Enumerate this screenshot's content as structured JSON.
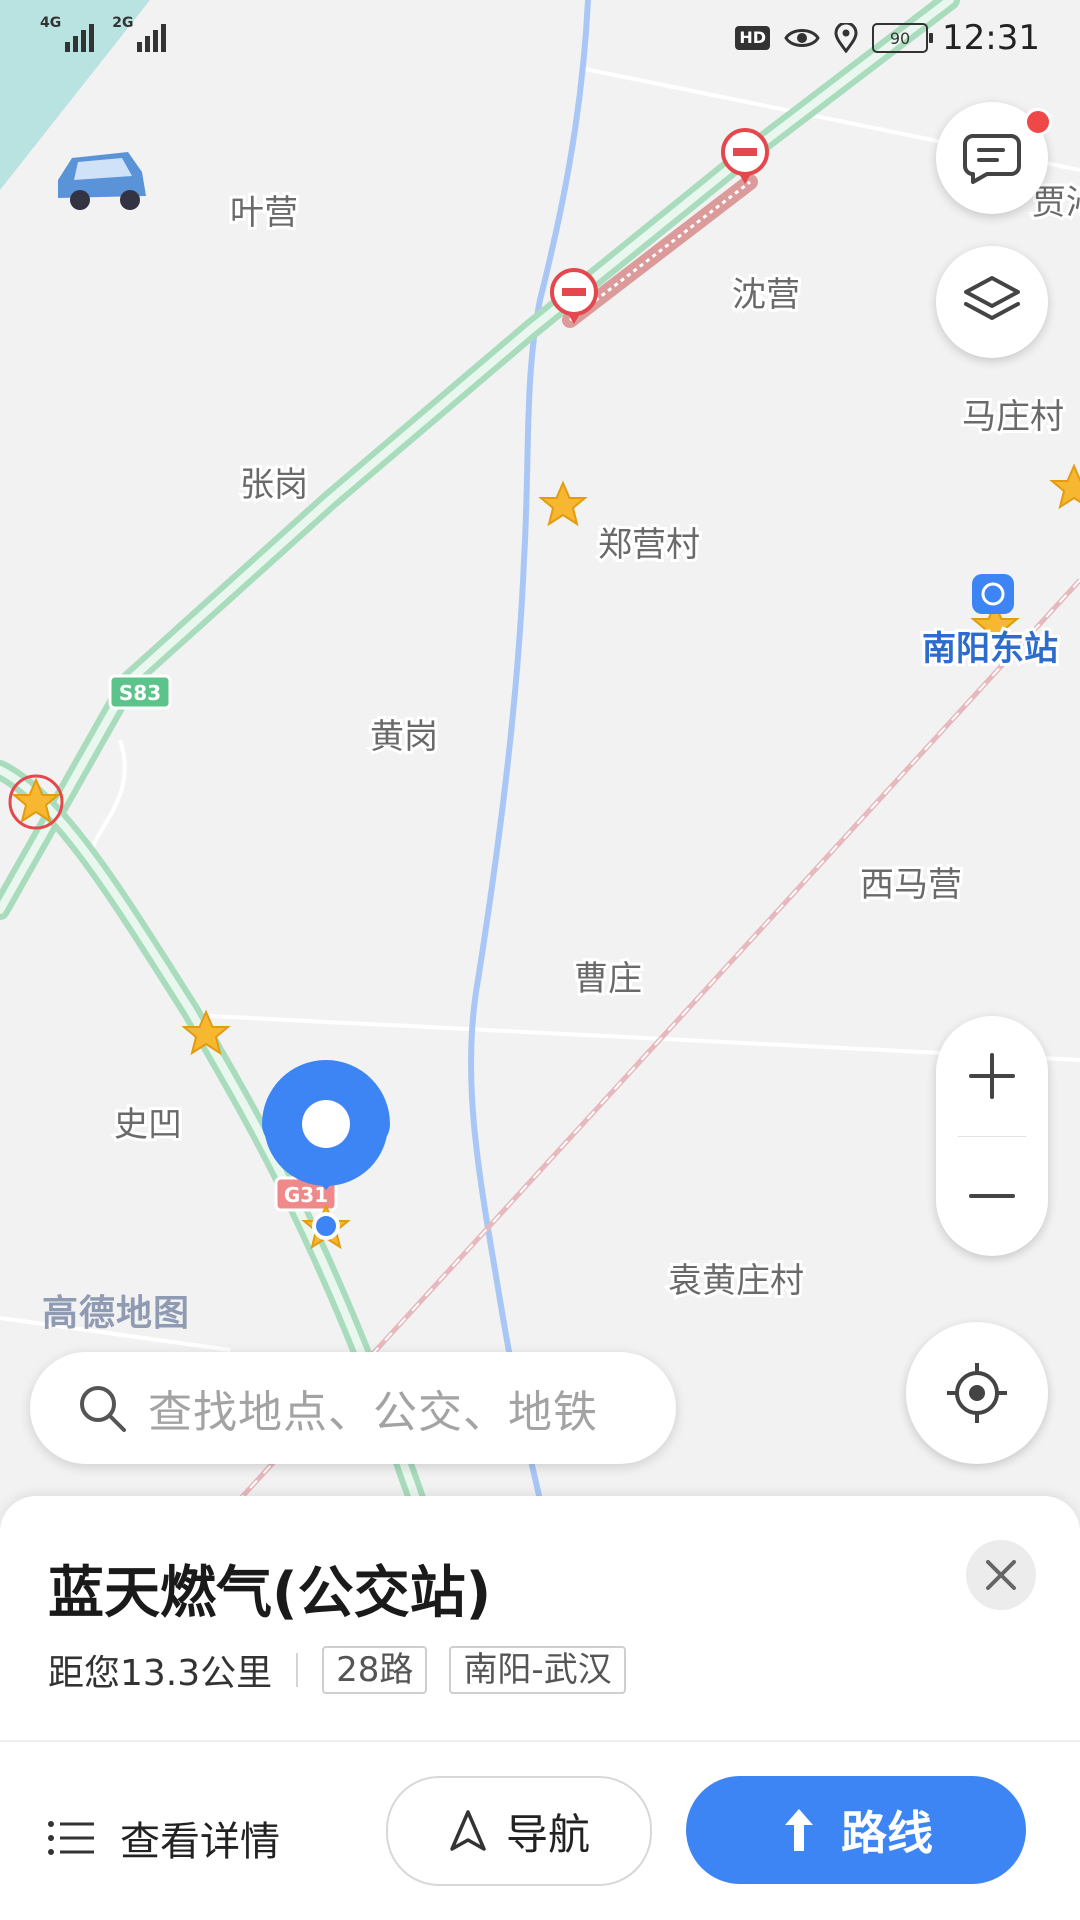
{
  "status_bar": {
    "net1": "4G",
    "net2": "2G",
    "hd": "HD",
    "battery": "90",
    "time": "12:31"
  },
  "map": {
    "places": [
      {
        "id": "yeying",
        "name": "叶营"
      },
      {
        "id": "shenying",
        "name": "沈营"
      },
      {
        "id": "jia",
        "name": "贾沁"
      },
      {
        "id": "mazhuangcun",
        "name": "马庄村"
      },
      {
        "id": "zhanggang",
        "name": "张岗"
      },
      {
        "id": "zhengyingcun",
        "name": "郑营村"
      },
      {
        "id": "huanggang",
        "name": "黄岗"
      },
      {
        "id": "ximaying",
        "name": "西马营"
      },
      {
        "id": "caozhuang",
        "name": "曹庄"
      },
      {
        "id": "shiao",
        "name": "史凹"
      },
      {
        "id": "yuanhuangzhuangcun",
        "name": "袁黄庄村"
      }
    ],
    "station_label": "南阳东站",
    "road_shield_s83": "S83",
    "road_shield_g31": "G31",
    "watermark": "高德地图"
  },
  "search": {
    "placeholder": "查找地点、公交、地铁"
  },
  "poi_panel": {
    "title": "蓝天燃气(公交站)",
    "distance": "距您13.3公里",
    "tags": [
      "28路",
      "南阳-武汉"
    ],
    "actions": {
      "details": "查看详情",
      "navigate": "导航",
      "route": "路线"
    }
  },
  "colors": {
    "accent": "#3d85f4",
    "highway": "#b7e5c9",
    "notification": "#f04848"
  }
}
